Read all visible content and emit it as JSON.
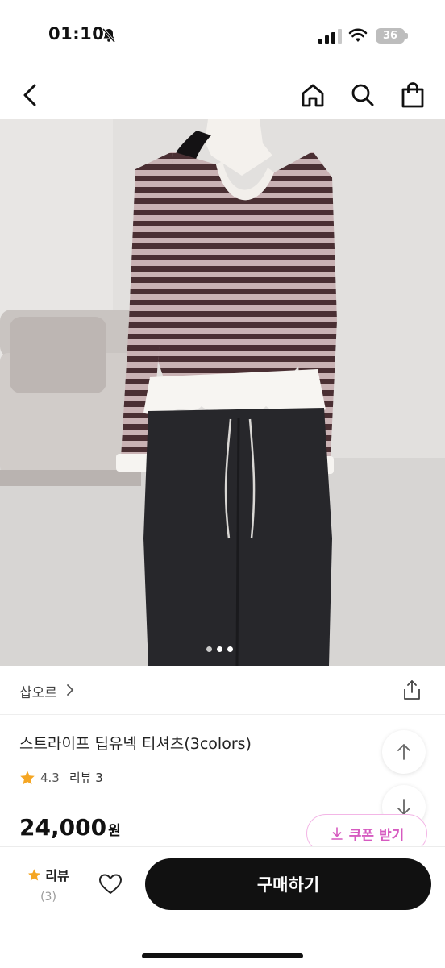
{
  "status": {
    "time": "01:10",
    "battery": "36"
  },
  "nav": {
    "back_icon": "chevron-left-icon",
    "home_icon": "home-icon",
    "search_icon": "search-icon",
    "bag_icon": "shopping-bag-icon"
  },
  "gallery": {
    "total": 3,
    "current": 1
  },
  "shop": {
    "name": "샵오르"
  },
  "product": {
    "title": "스트라이프 딥유넥 티셔츠(3colors)",
    "rating": "4.3",
    "review_link": "리뷰 3",
    "price": "24,000",
    "currency": "원"
  },
  "coupon": {
    "label": "쿠폰 받기"
  },
  "bottom": {
    "review_label": "리뷰",
    "review_count": "(3)",
    "buy_label": "구매하기"
  },
  "colors": {
    "accent_pink": "#d65ac0",
    "star": "#f5a623",
    "buy_button": "#111111"
  }
}
